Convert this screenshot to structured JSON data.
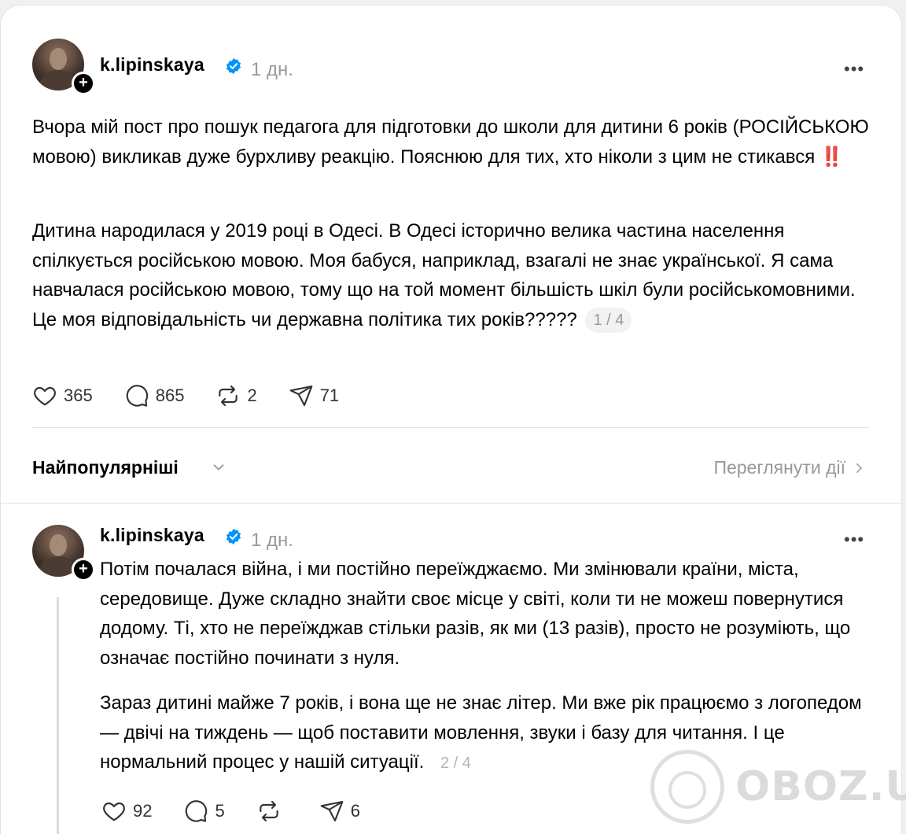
{
  "post1": {
    "username": "k.lipinskaya",
    "time": "1 дн.",
    "more": "•••",
    "paragraph1": "Вчора мій пост про пошук педагога для підготовки до школи для дитини 6 років (РОСІЙСЬКОЮ мовою) викликав дуже бурхливу реакцію. Пояснюю для тих, хто ніколи з цим не стикався ‼️",
    "paragraph2": "Дитина народилася у 2019 році в Одесі. В Одесі історично велика частина населення спілкується російською мовою. Моя бабуся, наприклад, взагалі не знає української. Я сама навчалася російською мовою, тому що на той момент більшість шкіл були російськомовними. Це моя відповідальність чи державна політика тих років?????",
    "pager": "1 / 4",
    "likes": "365",
    "comments": "865",
    "reposts": "2",
    "shares": "71"
  },
  "sort": {
    "label": "Найпопулярніші",
    "view_activity": "Переглянути дії"
  },
  "post2": {
    "username": "k.lipinskaya",
    "time": "1 дн.",
    "more": "•••",
    "paragraph1": "Потім почалася війна, і ми постійно переїжджаємо. Ми змінювали країни, міста, середовище. Дуже складно знайти своє місце у світі, коли ти не можеш повернутися додому. Ті, хто не переїжджав стільки разів, як ми (13 разів), просто не розуміють, що означає постійно починати з нуля.",
    "paragraph2": "Зараз дитині майже 7 років, і вона ще не знає літер. Ми вже рік працюємо з логопедом — двічі на тиждень — щоб поставити мовлення, звуки і базу для читання. І це нормальний процес у нашій ситуації.",
    "pager": "2 / 4",
    "likes": "92",
    "comments": "5",
    "reposts": "",
    "shares": "6"
  },
  "watermark": "OBOZ.UA",
  "icons": [
    "avatar",
    "plus-icon",
    "verified-icon",
    "more-icon",
    "heart-icon",
    "comment-icon",
    "repost-icon",
    "share-icon",
    "chevron-down-icon",
    "chevron-right-icon"
  ],
  "colors": {
    "verified": "#0095f6",
    "muted": "#999999",
    "divider": "#e3e3e3"
  }
}
